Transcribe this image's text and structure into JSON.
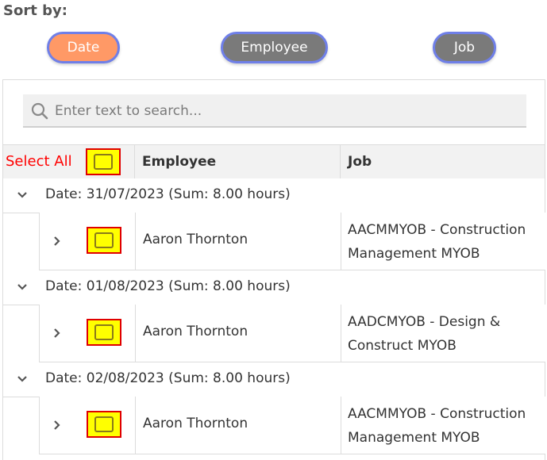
{
  "sort": {
    "label": "Sort by:",
    "buttons": [
      {
        "label": "Date",
        "active": true
      },
      {
        "label": "Employee",
        "active": false
      },
      {
        "label": "Job",
        "active": false
      }
    ]
  },
  "search": {
    "placeholder": "Enter text to search..."
  },
  "grid": {
    "select_all_label": "Select All",
    "columns": [
      "Employee",
      "Job"
    ],
    "groups": [
      {
        "label": "Date: 31/07/2023 (Sum: 8.00 hours)",
        "rows": [
          {
            "employee": "Aaron Thornton",
            "job": "AACMMYOB - Construction Management MYOB"
          }
        ]
      },
      {
        "label": "Date: 01/08/2023 (Sum: 8.00 hours)",
        "rows": [
          {
            "employee": "Aaron Thornton",
            "job": "AADCMYOB - Design & Construct MYOB"
          }
        ]
      },
      {
        "label": "Date: 02/08/2023 (Sum: 8.00 hours)",
        "rows": [
          {
            "employee": "Aaron Thornton",
            "job": "AACMMYOB - Construction Management MYOB"
          }
        ]
      }
    ]
  },
  "colors": {
    "active_sort": "#ff9966",
    "inactive_sort": "#7a7a7a",
    "sort_border": "#6f7fe8",
    "checkbox_fill": "#ffff00",
    "checkbox_border": "#e00000",
    "select_all_text": "#ff0000"
  },
  "icons": {
    "search": "search-icon",
    "group_expanded": "chevron-down-icon",
    "row_collapsed": "chevron-right-icon"
  }
}
